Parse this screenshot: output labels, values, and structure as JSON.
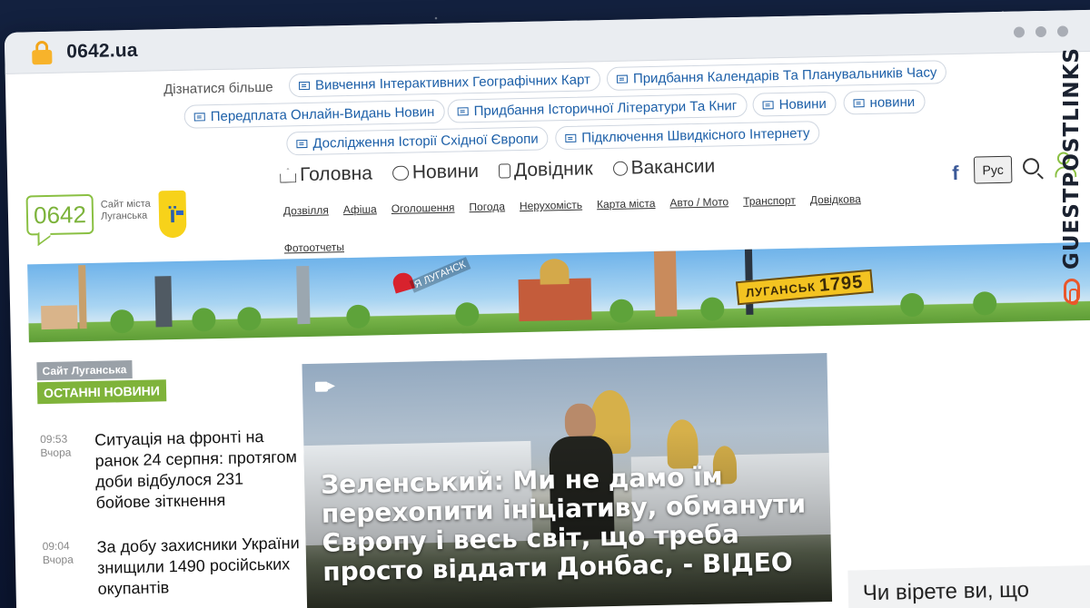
{
  "browser": {
    "url": "0642.ua"
  },
  "learn_more": {
    "label": "Дізнатися більше",
    "chips": [
      "Вивчення Інтерактивних Географічних Карт",
      "Придбання Календарів Та Планувальників Часу",
      "Передплата Онлайн-Видань Новин",
      "Придбання Історичної Літератури Та Книг",
      "Новини",
      "новини",
      "Дослідження Історії Східної Європи",
      "Підключення Швидкісного Інтернету"
    ]
  },
  "logo": {
    "number": "0642",
    "caption_line1": "Сайт міста",
    "caption_line2": "Луганська",
    "badge": "ї"
  },
  "main_nav": [
    {
      "label": "Головна",
      "icon": "home-icon"
    },
    {
      "label": "Новини",
      "icon": "chat-icon"
    },
    {
      "label": "Довідник",
      "icon": "book-icon"
    },
    {
      "label": "Вакансии",
      "icon": "briefcase-icon"
    }
  ],
  "sub_nav": [
    "Дозвілля",
    "Афіша",
    "Оголошення",
    "Погода",
    "Нерухомість",
    "Карта міста",
    "Авто / Мото",
    "Транспорт",
    "Довідкова",
    "Фотоотчеты"
  ],
  "header_tools": {
    "facebook": "f",
    "language_button": "Рус"
  },
  "banner": {
    "sign_small": "ЛУГАНСЬК",
    "sign_year": "1795",
    "love_text": "Я ЛУГАНСК"
  },
  "sidebar": {
    "site_tag": "Сайт Луганська",
    "section_title": "ОСТАННІ НОВИНИ",
    "news": [
      {
        "time": "09:53",
        "day": "Вчора",
        "title": "Ситуація на фронті на ранок 24 серпня: протягом доби відбулося 231 бойове зіткнення"
      },
      {
        "time": "09:04",
        "day": "Вчора",
        "title": "За добу захисники України знищили 1490 російських окупантів"
      }
    ]
  },
  "hero": {
    "title": "Зеленський: Ми не дамо їм перехопити ініціативу, обманути Європу і весь світ, що треба просто віддати Донбас, - ВІДЕО"
  },
  "poll": {
    "title": "Чи вірете ви, що"
  },
  "watermark": {
    "text": "GUESTPOSTLINKS"
  },
  "colors": {
    "accent_green": "#7fb33a",
    "link_blue": "#1c5fa8",
    "lock_orange": "#f7b32b"
  }
}
